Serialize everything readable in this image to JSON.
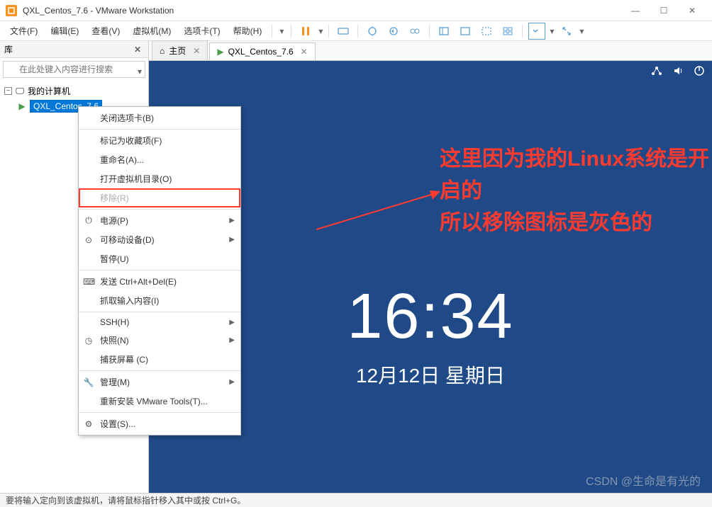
{
  "window": {
    "title": "QXL_Centos_7.6 - VMware Workstation",
    "min": "—",
    "max": "☐",
    "close": "✕"
  },
  "menubar": {
    "file": "文件(F)",
    "edit": "编辑(E)",
    "view": "查看(V)",
    "vm": "虚拟机(M)",
    "tabs": "选项卡(T)",
    "help": "帮助(H)"
  },
  "sidebar": {
    "title": "库",
    "search_placeholder": "在此处键入内容进行搜索",
    "root": "我的计算机",
    "vm_item": "QXL_Centos_7.6"
  },
  "tabs_area": {
    "home": "主页",
    "vm": "QXL_Centos_7.6"
  },
  "context_menu": {
    "close_tab": "关闭选项卡(B)",
    "favorite": "标记为收藏项(F)",
    "rename": "重命名(A)...",
    "open_dir": "打开虚拟机目录(O)",
    "remove": "移除(R)",
    "power": "电源(P)",
    "removable": "可移动设备(D)",
    "pause": "暂停(U)",
    "send_cad": "发送 Ctrl+Alt+Del(E)",
    "grab_input": "抓取输入内容(I)",
    "ssh": "SSH(H)",
    "snapshot": "快照(N)",
    "capture": "捕获屏幕 (C)",
    "manage": "管理(M)",
    "vmtools": "重新安装 VMware Tools(T)...",
    "settings": "设置(S)..."
  },
  "annotation": {
    "line1": "这里因为我的Linux系统是开启的",
    "line2": "所以移除图标是灰色的"
  },
  "clock": {
    "time": "16:34",
    "date": "12月12日 星期日"
  },
  "statusbar": {
    "text": "要将输入定向到该虚拟机，请将鼠标指针移入其中或按 Ctrl+G。"
  },
  "watermark": "CSDN @生命是有光的"
}
